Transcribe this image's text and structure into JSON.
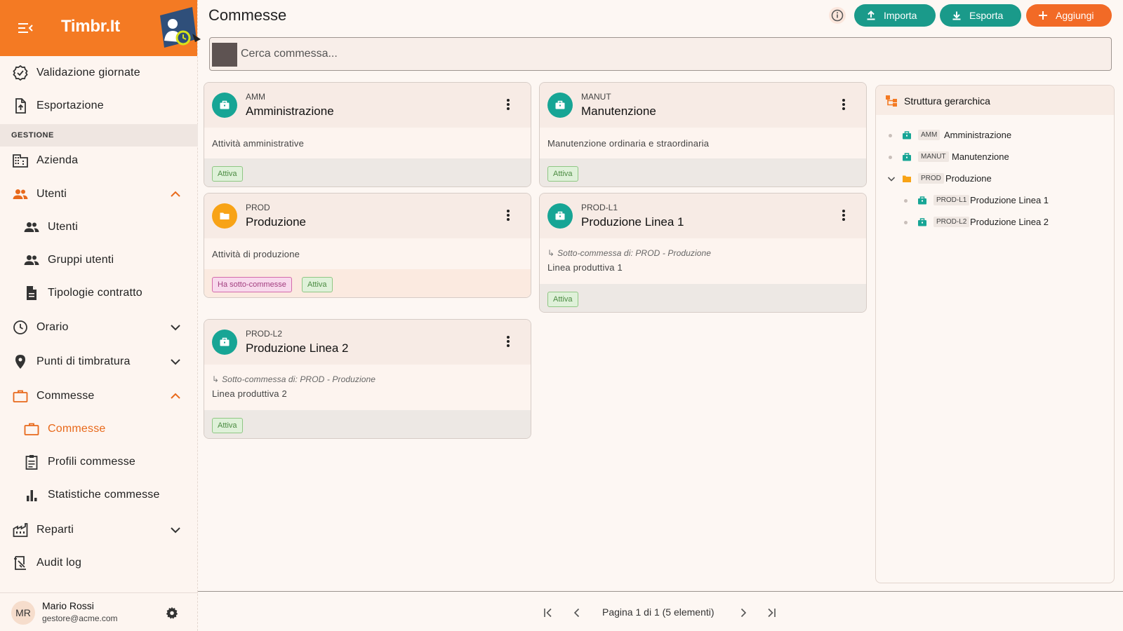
{
  "app": {
    "logo": "Timbr.It",
    "title": "Commesse"
  },
  "sidebar": {
    "items_top": [
      {
        "label": "Validazione giornate"
      },
      {
        "label": "Esportazione"
      }
    ],
    "section_label": "GESTIONE",
    "items": [
      {
        "label": "Azienda"
      },
      {
        "label": "Utenti"
      },
      {
        "label": "Utenti"
      },
      {
        "label": "Gruppi utenti"
      },
      {
        "label": "Tipologie contratto"
      },
      {
        "label": "Orario"
      },
      {
        "label": "Punti di timbratura"
      },
      {
        "label": "Commesse"
      },
      {
        "label": "Commesse"
      },
      {
        "label": "Profili commesse"
      },
      {
        "label": "Statistiche commesse"
      },
      {
        "label": "Reparti"
      },
      {
        "label": "Audit log"
      }
    ],
    "user": {
      "initials": "MR",
      "name": "Mario Rossi",
      "email": "gestore@acme.com"
    }
  },
  "toolbar": {
    "import_label": "Importa",
    "export_label": "Esporta",
    "add_label": "Aggiungi"
  },
  "search": {
    "placeholder": "Cerca commessa..."
  },
  "cards": [
    {
      "code": "AMM",
      "name": "Amministrazione",
      "description": "Attività amministrative",
      "chips": [
        "Attiva"
      ]
    },
    {
      "code": "MANUT",
      "name": "Manutenzione",
      "description": "Manutenzione ordinaria e straordinaria",
      "chips": [
        "Attiva"
      ]
    },
    {
      "code": "PROD",
      "name": "Produzione",
      "description": "Attività di produzione",
      "chips": [
        "Ha sotto-commesse",
        "Attiva"
      ]
    },
    {
      "code": "PROD-L1",
      "name": "Produzione Linea 1",
      "parent": "Sotto-commessa di: PROD - Produzione",
      "description": "Linea produttiva 1",
      "chips": [
        "Attiva"
      ]
    },
    {
      "code": "PROD-L2",
      "name": "Produzione Linea 2",
      "parent": "Sotto-commessa di: PROD - Produzione",
      "description": "Linea produttiva 2",
      "chips": [
        "Attiva"
      ]
    }
  ],
  "tree": {
    "title": "Struttura gerarchica",
    "nodes": [
      {
        "code": "AMM",
        "label": "Amministrazione"
      },
      {
        "code": "MANUT",
        "label": "Manutenzione"
      },
      {
        "code": "PROD",
        "label": "Produzione"
      },
      {
        "code": "PROD-L1",
        "label": "Produzione Linea 1"
      },
      {
        "code": "PROD-L2",
        "label": "Produzione Linea 2"
      }
    ]
  },
  "pagination": {
    "text": "Pagina 1 di 1 (5 elementi)"
  },
  "colors": {
    "brand": "#f47a23",
    "teal": "#1a9a8a",
    "add": "#f26a26",
    "folder": "#f8a316"
  },
  "icons": {
    "briefcase": "briefcase-icon",
    "folder": "folder-icon",
    "search": "search-icon",
    "info": "info-icon",
    "upload": "upload-icon",
    "download": "download-icon",
    "plus": "plus-icon",
    "more": "more-vert-icon",
    "gear": "gear-icon",
    "hierarchy": "hierarchy-icon",
    "menu": "menu-collapse-icon"
  }
}
